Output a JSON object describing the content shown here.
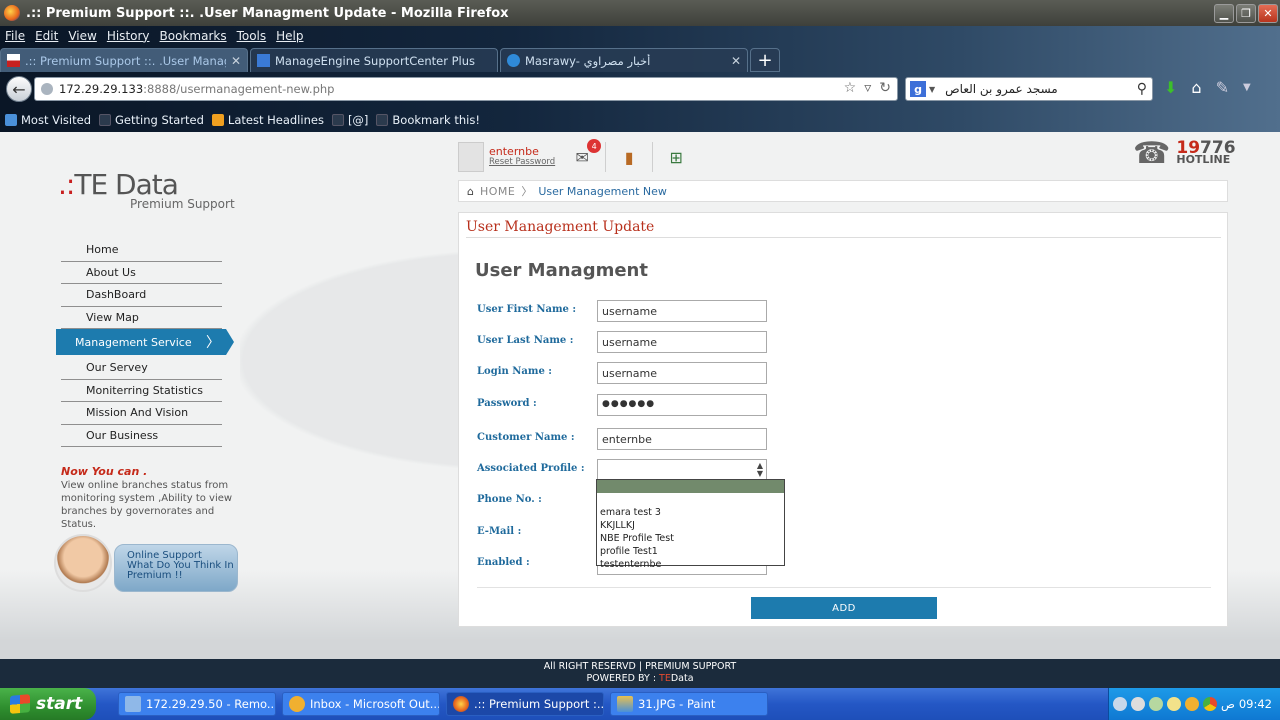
{
  "window": {
    "title": ".:: Premium Support ::. .User Managment Update - Mozilla Firefox"
  },
  "menu": [
    "File",
    "Edit",
    "View",
    "History",
    "Bookmarks",
    "Tools",
    "Help"
  ],
  "tabs": [
    {
      "label": ".:: Premium Support ::. .User Managment Update",
      "active": true
    },
    {
      "label": "ManageEngine SupportCenter Plus",
      "active": false
    },
    {
      "label": "Masrawy- أخبار مصراوي",
      "active": false
    }
  ],
  "url": {
    "host": "172.29.29.133",
    "path": ":8888/usermanagement-new.php"
  },
  "search": {
    "engine": "g",
    "query": "مسجد عمرو بن العاص"
  },
  "bookmarks": [
    "Most Visited",
    "Getting Started",
    "Latest Headlines",
    "[@]",
    "Bookmark this!"
  ],
  "logo": {
    "brand": "TE Data",
    "sub": "Premium Support"
  },
  "sidebar": {
    "items": [
      {
        "label": "Home"
      },
      {
        "label": "About Us"
      },
      {
        "label": "DashBoard"
      },
      {
        "label": "View Map"
      },
      {
        "label": "Management Service",
        "active": true
      },
      {
        "label": "Our Servey"
      },
      {
        "label": "Moniterring Statistics"
      },
      {
        "label": "Mission And Vision"
      },
      {
        "label": "Our Business"
      }
    ],
    "now_heading": "Now You can .",
    "now_text": "View online branches status from monitoring system ,Ability to view branches by governorates and Status.",
    "support_line1": "Online Support",
    "support_line2": "What Do You Think In",
    "support_line3": "Premium !!"
  },
  "user": {
    "name": "enternbe",
    "reset": "Reset Password",
    "notifications": "4"
  },
  "hotline": {
    "number_a": "19",
    "number_b": "776",
    "label": "HOTLINE"
  },
  "breadcrumb": {
    "home": "HOME",
    "current": "User Management New"
  },
  "panel": {
    "title": "User Management Update",
    "heading": "User Managment",
    "fields": [
      {
        "label": "User First Name :",
        "value": "username"
      },
      {
        "label": "User Last Name :",
        "value": "username"
      },
      {
        "label": "Login Name :",
        "value": "username"
      },
      {
        "label": "Password :",
        "value": "●●●●●●"
      },
      {
        "label": "Customer Name :",
        "value": "enternbe"
      },
      {
        "label": "Associated Profile :",
        "value": ""
      },
      {
        "label": "Phone No. :",
        "value": ""
      },
      {
        "label": "E-Mail :",
        "value": ""
      },
      {
        "label": "Enabled :",
        "value": ""
      }
    ],
    "profile_options": [
      "",
      "emara test 3",
      "KKJLLKJ",
      "NBE Profile Test",
      "profile Test1",
      "testenternbe"
    ],
    "add_label": "ADD"
  },
  "footer": {
    "line1": "All RIGHT RESERVD | PREMIUM SUPPORT",
    "line2_prefix": "POWERED BY : ",
    "line2_te": "TE",
    "line2_rest": "Data"
  },
  "taskbar": {
    "start": "start",
    "items": [
      {
        "label": "172.29.29.50 - Remo..."
      },
      {
        "label": "Inbox - Microsoft Out..."
      },
      {
        "label": ".:: Premium Support :...",
        "active": true
      },
      {
        "label": "31.JPG - Paint"
      }
    ],
    "clock": "09:42",
    "ampm": "ص"
  }
}
